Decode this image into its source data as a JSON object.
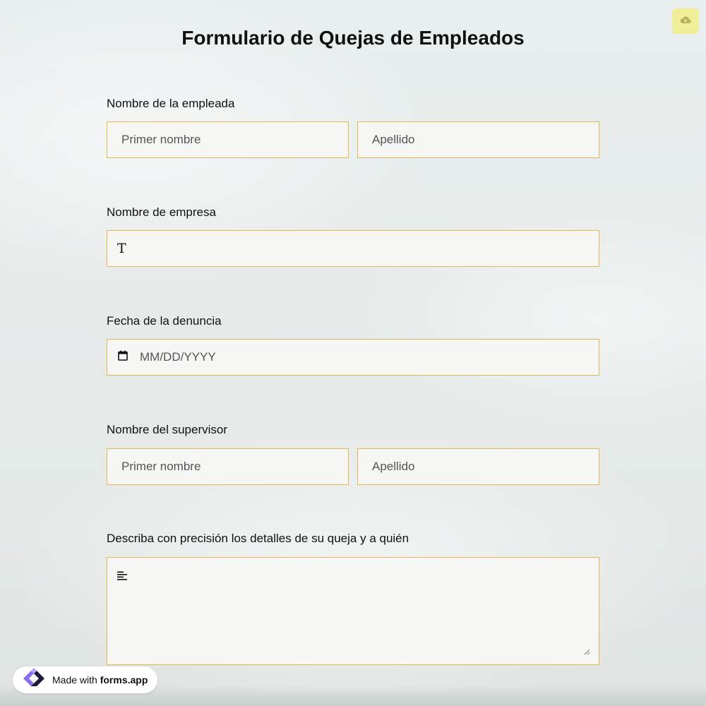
{
  "form": {
    "title": "Formulario de Quejas de Empleados",
    "fields": {
      "employee_name": {
        "label": "Nombre de la empleada",
        "first_placeholder": "Primer nombre",
        "last_placeholder": "Apellido"
      },
      "company_name": {
        "label": "Nombre de empresa",
        "icon": "text-type-icon"
      },
      "complaint_date": {
        "label": "Fecha de la denuncia",
        "placeholder": "MM/DD/YYYY",
        "icon": "calendar-icon"
      },
      "supervisor_name": {
        "label": "Nombre del supervisor",
        "first_placeholder": "Primer nombre",
        "last_placeholder": "Apellido"
      },
      "details": {
        "label": "Describa con precisión los detalles de su queja y a quién",
        "icon": "paragraph-lines-icon"
      }
    }
  },
  "toolbar": {
    "save_icon": "cloud-upload-icon",
    "save_color": "#f1ee9a"
  },
  "badge": {
    "prefix": "Made with",
    "brand": "forms.app",
    "logo_icon": "forms-app-logo-icon"
  },
  "colors": {
    "field_border": "#e4b84d",
    "field_bg": "#f6f7f5",
    "text": "#111111"
  }
}
